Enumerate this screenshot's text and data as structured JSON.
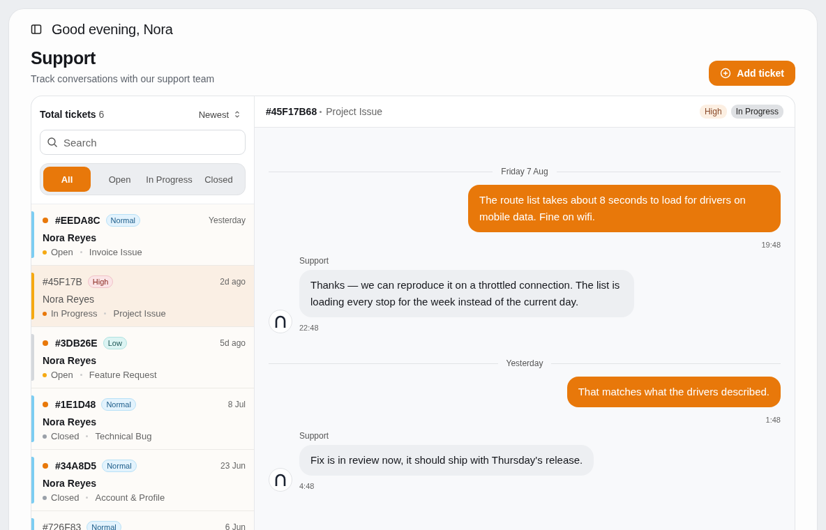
{
  "header": {
    "greeting": "Good evening, Nora",
    "title": "Support",
    "subtitle": "Track conversations with our support team",
    "add_button": "Add ticket"
  },
  "ticket_list": {
    "title": "Total tickets",
    "count": "6",
    "sort": "Newest",
    "search": {
      "placeholder": "Search"
    },
    "filters": [
      {
        "label": "All",
        "selected": true
      },
      {
        "label": "Open",
        "selected": false
      },
      {
        "label": "In Progress",
        "selected": false
      },
      {
        "label": "Closed",
        "selected": false
      }
    ],
    "tickets": [
      {
        "id": "#EEDA8C",
        "priority": {
          "label": "Normal",
          "kind": "normal"
        },
        "time": "Yesterday",
        "name": "Nora Reyes",
        "status": {
          "label": "Open",
          "kind": "open"
        },
        "category": "Invoice Issue",
        "unread": true,
        "selected": false
      },
      {
        "id": "#45F17B",
        "priority": {
          "label": "High",
          "kind": "high"
        },
        "time": "2d ago",
        "name": "Nora Reyes",
        "status": {
          "label": "In Progress",
          "kind": "progress"
        },
        "category": "Project Issue",
        "unread": false,
        "selected": true
      },
      {
        "id": "#3DB26E",
        "priority": {
          "label": "Low",
          "kind": "low"
        },
        "time": "5d ago",
        "name": "Nora Reyes",
        "status": {
          "label": "Open",
          "kind": "open"
        },
        "category": "Feature Request",
        "unread": true,
        "selected": false
      },
      {
        "id": "#1E1D48",
        "priority": {
          "label": "Normal",
          "kind": "normal"
        },
        "time": "8 Jul",
        "name": "Nora Reyes",
        "status": {
          "label": "Closed",
          "kind": "closed"
        },
        "category": "Technical Bug",
        "unread": true,
        "selected": false
      },
      {
        "id": "#34A8D5",
        "priority": {
          "label": "Normal",
          "kind": "normal"
        },
        "time": "23 Jun",
        "name": "Nora Reyes",
        "status": {
          "label": "Closed",
          "kind": "closed"
        },
        "category": "Account & Profile",
        "unread": true,
        "selected": false
      },
      {
        "id": "#726F83",
        "priority": {
          "label": "Normal",
          "kind": "normal"
        },
        "time": "6 Jun",
        "unread": false,
        "selected": false
      }
    ]
  },
  "conversation": {
    "id": "#45F17B68",
    "category": "Project Issue",
    "priority": {
      "label": "High",
      "kind": "high"
    },
    "status": "In Progress",
    "messages": [
      {
        "kind": "date",
        "text": "Friday 7 Aug"
      },
      {
        "kind": "user",
        "text": "The route list takes about 8 seconds to load for drivers on mobile data. Fine on wifi.",
        "time": "19:48"
      },
      {
        "kind": "support",
        "sender": "Support",
        "text": "Thanks — we can reproduce it on a throttled connection. The list is loading every stop for the week instead of the current day.",
        "time": "22:48"
      },
      {
        "kind": "date",
        "text": "Yesterday"
      },
      {
        "kind": "user",
        "text": "That matches what the drivers described.",
        "time": "1:48"
      },
      {
        "kind": "support",
        "sender": "Support",
        "text": "Fix is in review now, it should ship with Thursday's release.",
        "time": "4:48"
      }
    ]
  }
}
